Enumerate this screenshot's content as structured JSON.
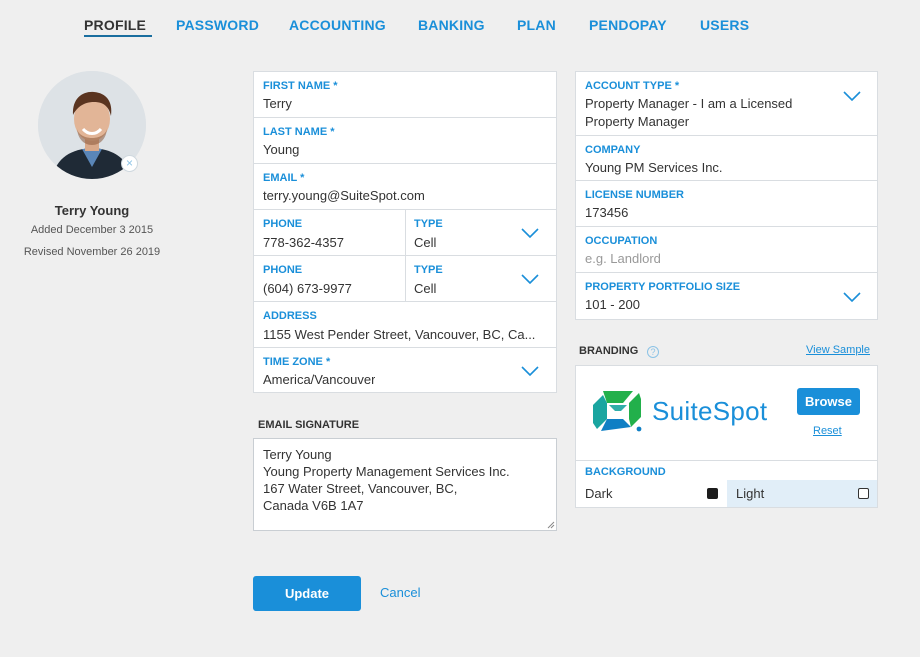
{
  "tabs": [
    {
      "label": "PROFILE",
      "active": true
    },
    {
      "label": "PASSWORD"
    },
    {
      "label": "ACCOUNTING"
    },
    {
      "label": "BANKING"
    },
    {
      "label": "PLAN"
    },
    {
      "label": "PENDOPAY"
    },
    {
      "label": "USERS"
    }
  ],
  "user": {
    "name": "Terry Young",
    "added": "Added December 3 2015",
    "revised": "Revised November 26 2019",
    "remove_icon": "×"
  },
  "personal": {
    "first_name": {
      "label": "FIRST NAME *",
      "value": "Terry"
    },
    "last_name": {
      "label": "LAST NAME *",
      "value": "Young"
    },
    "email": {
      "label": "EMAIL *",
      "value": "terry.young@SuiteSpot.com"
    },
    "phone1": {
      "label": "PHONE",
      "value": "778-362-4357",
      "type_label": "TYPE",
      "type_value": "Cell"
    },
    "phone2": {
      "label": "PHONE",
      "value": "(604) 673-9977",
      "type_label": "TYPE",
      "type_value": "Cell"
    },
    "address": {
      "label": "ADDRESS",
      "value": "1155 West Pender Street, Vancouver, BC, Ca..."
    },
    "time_zone": {
      "label": "TIME ZONE *",
      "value": "America/Vancouver"
    }
  },
  "signature": {
    "label": "EMAIL SIGNATURE",
    "lines": [
      "Terry Young",
      "Young Property Management Services Inc.",
      "167 Water Street, Vancouver, BC,",
      "Canada V6B 1A7"
    ]
  },
  "business": {
    "account_type": {
      "label": "ACCOUNT TYPE *",
      "line1": "Property Manager - I am a Licensed",
      "line2": "Property Manager"
    },
    "company": {
      "label": "COMPANY",
      "value": "Young PM Services Inc."
    },
    "license": {
      "label": "LICENSE NUMBER",
      "value": "173456"
    },
    "occupation": {
      "label": "OCCUPATION",
      "placeholder": "e.g. Landlord"
    },
    "portfolio": {
      "label": "PROPERTY PORTFOLIO SIZE",
      "value": "101 - 200"
    }
  },
  "branding": {
    "label": "BRANDING",
    "help_icon": "?",
    "view_sample": "View Sample",
    "logo_text": "SuiteSpot",
    "browse": "Browse",
    "reset": "Reset",
    "background_label": "BACKGROUND",
    "options": [
      {
        "label": "Dark",
        "selected": false
      },
      {
        "label": "Light",
        "selected": true
      }
    ]
  },
  "actions": {
    "update": "Update",
    "cancel": "Cancel"
  },
  "colors": {
    "accent": "#1a8fd9",
    "selected_bg": "#e1eef8",
    "logo_green": "#22b04b"
  }
}
